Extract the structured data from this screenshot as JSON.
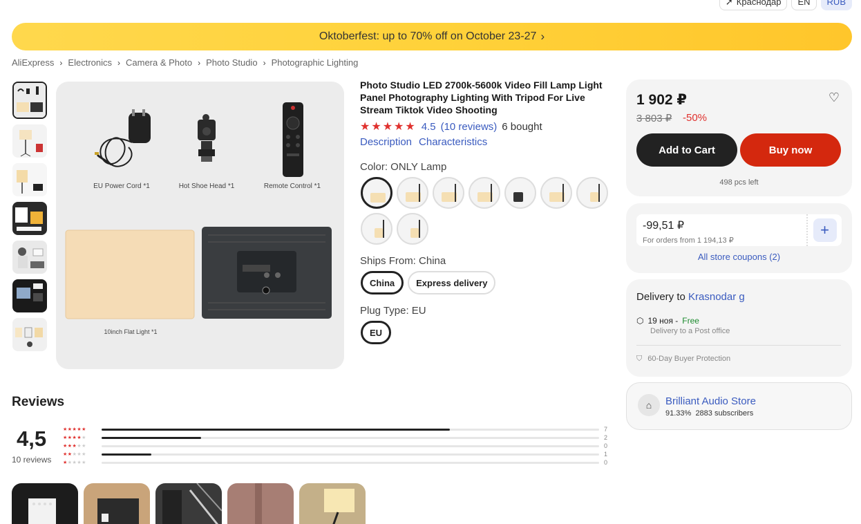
{
  "header": {
    "location": "Краснодар",
    "language": "EN",
    "currency": "RUB"
  },
  "banner": {
    "text": "Oktoberfest: up to 70% off on October 23-27"
  },
  "breadcrumb": [
    "AliExpress",
    "Electronics",
    "Camera & Photo",
    "Photo Studio",
    "Photographic Lighting"
  ],
  "gallery": {
    "captions": {
      "power": "EU Power Cord *1",
      "shoe": "Hot Shoe Head *1",
      "remote": "Remote Control *1",
      "light": "10inch Flat Light *1"
    }
  },
  "product": {
    "title": "Photo Studio LED 2700k-5600k Video Fill Lamp Light Panel Photography Lighting With Tripod For Live Stream Tiktok Video Shooting",
    "stars": "★★★★★",
    "rating": "4.5",
    "reviews_link": "(10 reviews)",
    "bought": "6 bought",
    "links": {
      "description": "Description",
      "characteristics": "Characteristics"
    },
    "color_label": "Color: ONLY Lamp",
    "ships_label": "Ships From: China",
    "ships_options": [
      "China",
      "Express delivery"
    ],
    "plug_label": "Plug Type: EU",
    "plug_options": [
      "EU"
    ]
  },
  "buy_box": {
    "price": "1 902 ₽",
    "old_price": "3 803 ₽",
    "discount": "-50%",
    "add_to_cart": "Add to Cart",
    "buy_now": "Buy now",
    "stock": "498 pcs left"
  },
  "coupon": {
    "value": "-99,51 ₽",
    "condition": "For orders from 1 194,13 ₽",
    "add": "+",
    "all": "All store coupons (2)"
  },
  "delivery": {
    "prefix": "Delivery to",
    "city": "Krasnodar g",
    "date": "19 ноя -",
    "cost": "Free",
    "method": "Delivery to a Post office",
    "protection": "60-Day Buyer Protection"
  },
  "store": {
    "name": "Brilliant Audio Store",
    "rating": "91.33%",
    "subscribers": "2883 subscribers"
  },
  "reviews": {
    "title": "Reviews",
    "score": "4,5",
    "count": "10 reviews",
    "breakdown": [
      {
        "stars": 5,
        "count": "7",
        "fraction": 0.7
      },
      {
        "stars": 4,
        "count": "2",
        "fraction": 0.2
      },
      {
        "stars": 3,
        "count": "0",
        "fraction": 0
      },
      {
        "stars": 2,
        "count": "1",
        "fraction": 0.1
      },
      {
        "stars": 1,
        "count": "0",
        "fraction": 0
      }
    ]
  },
  "colors": {
    "accent_red": "#e0312e",
    "link_blue": "#3a5bbf",
    "buy_red": "#d4280e",
    "banner_yellow": "#ffd23a"
  }
}
